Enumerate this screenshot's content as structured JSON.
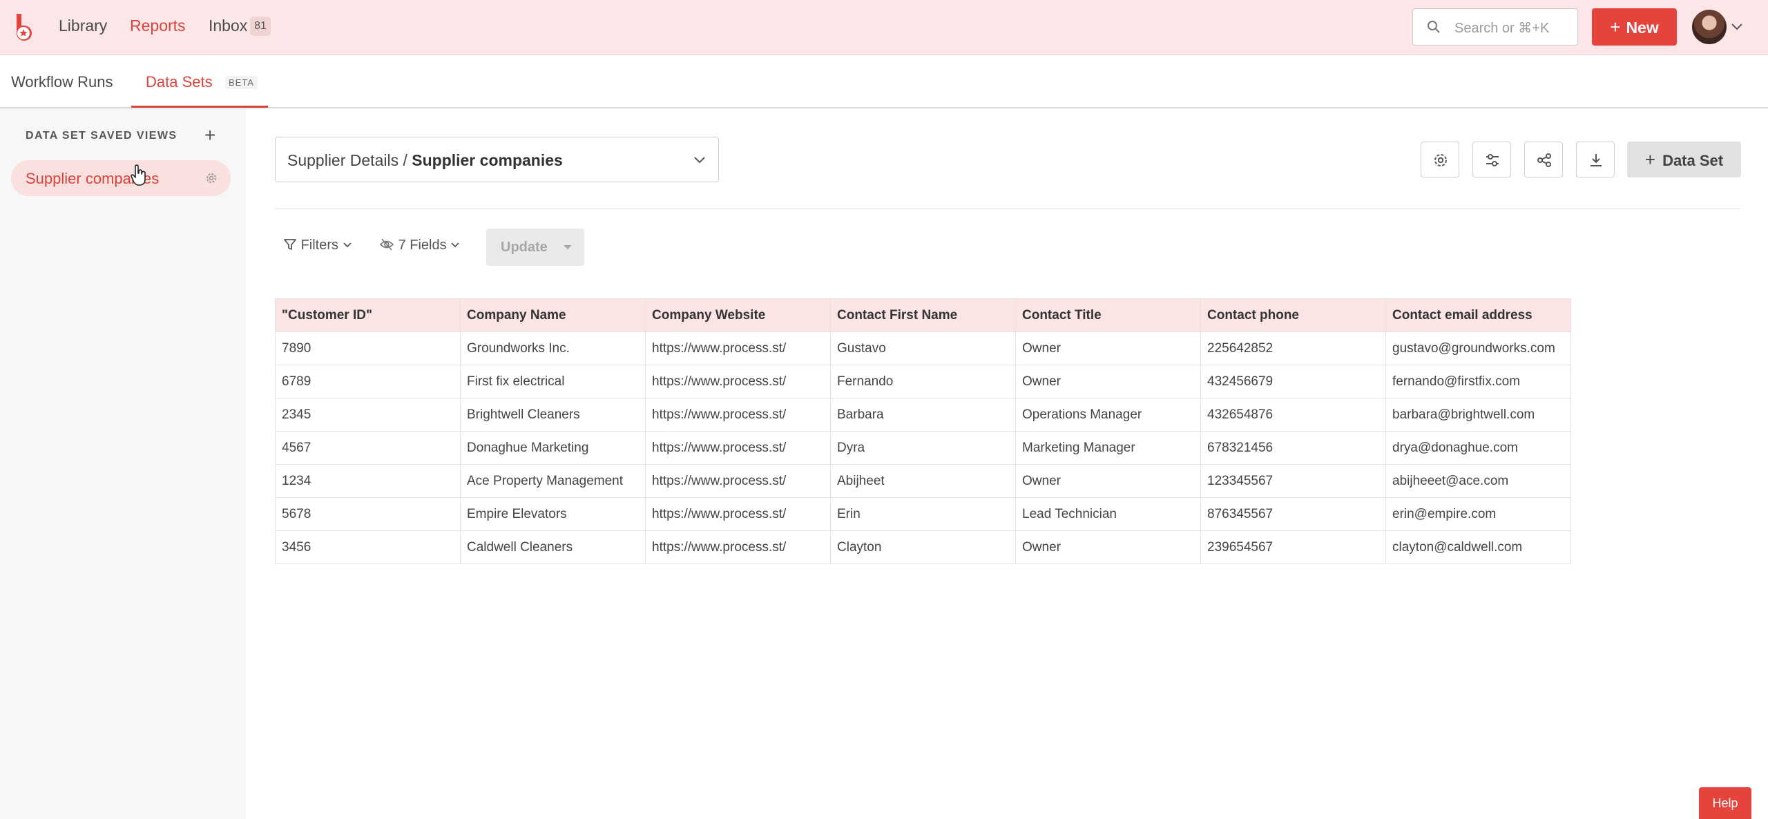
{
  "topnav": {
    "library": "Library",
    "reports": "Reports",
    "inbox": "Inbox",
    "inbox_count": "81",
    "search_placeholder": "Search or ⌘+K",
    "new_label": "New"
  },
  "subnav": {
    "workflow_runs": "Workflow Runs",
    "data_sets": "Data Sets",
    "beta": "BETA"
  },
  "sidebar": {
    "heading": "DATA SET SAVED VIEWS",
    "add_icon": "plus-icon",
    "saved_views": [
      {
        "label": "Supplier companies",
        "icon": "gear-icon"
      }
    ]
  },
  "main": {
    "selector": {
      "prefix": "Supplier Details /",
      "name": "Supplier companies"
    },
    "actions": [
      "gear-icon",
      "sliders-icon",
      "share-icon",
      "download-icon"
    ],
    "dataset_button": "Data Set",
    "filters": "Filters",
    "fields": "7 Fields",
    "update": "Update"
  },
  "table": {
    "columns": [
      "\"Customer ID\"",
      "Company Name",
      "Company Website",
      "Contact First Name",
      "Contact Title",
      "Contact phone",
      "Contact email address"
    ],
    "rows": [
      [
        "7890",
        "Groundworks Inc.",
        "https://www.process.st/",
        "Gustavo",
        "Owner",
        "225642852",
        "gustavo@groundworks.com"
      ],
      [
        "6789",
        "First fix electrical",
        "https://www.process.st/",
        "Fernando",
        "Owner",
        "432456679",
        "fernando@firstfix.com"
      ],
      [
        "2345",
        "Brightwell Cleaners",
        "https://www.process.st/",
        "Barbara",
        "Operations Manager",
        "432654876",
        "barbara@brightwell.com"
      ],
      [
        "4567",
        "Donaghue Marketing",
        "https://www.process.st/",
        "Dyra",
        "Marketing Manager",
        "678321456",
        "drya@donaghue.com"
      ],
      [
        "1234",
        "Ace Property Management",
        "https://www.process.st/",
        "Abijheet",
        "Owner",
        "123345567",
        "abijheeet@ace.com"
      ],
      [
        "5678",
        "Empire Elevators",
        "https://www.process.st/",
        "Erin",
        "Lead Technician",
        "876345567",
        "erin@empire.com"
      ],
      [
        "3456",
        "Caldwell Cleaners",
        "https://www.process.st/",
        "Clayton",
        "Owner",
        "239654567",
        "clayton@caldwell.com"
      ]
    ]
  },
  "help": "Help",
  "colors": {
    "accent": "#e4443c",
    "topbar_bg": "#fbe7e7",
    "header_row_bg": "#fbe4e4"
  }
}
